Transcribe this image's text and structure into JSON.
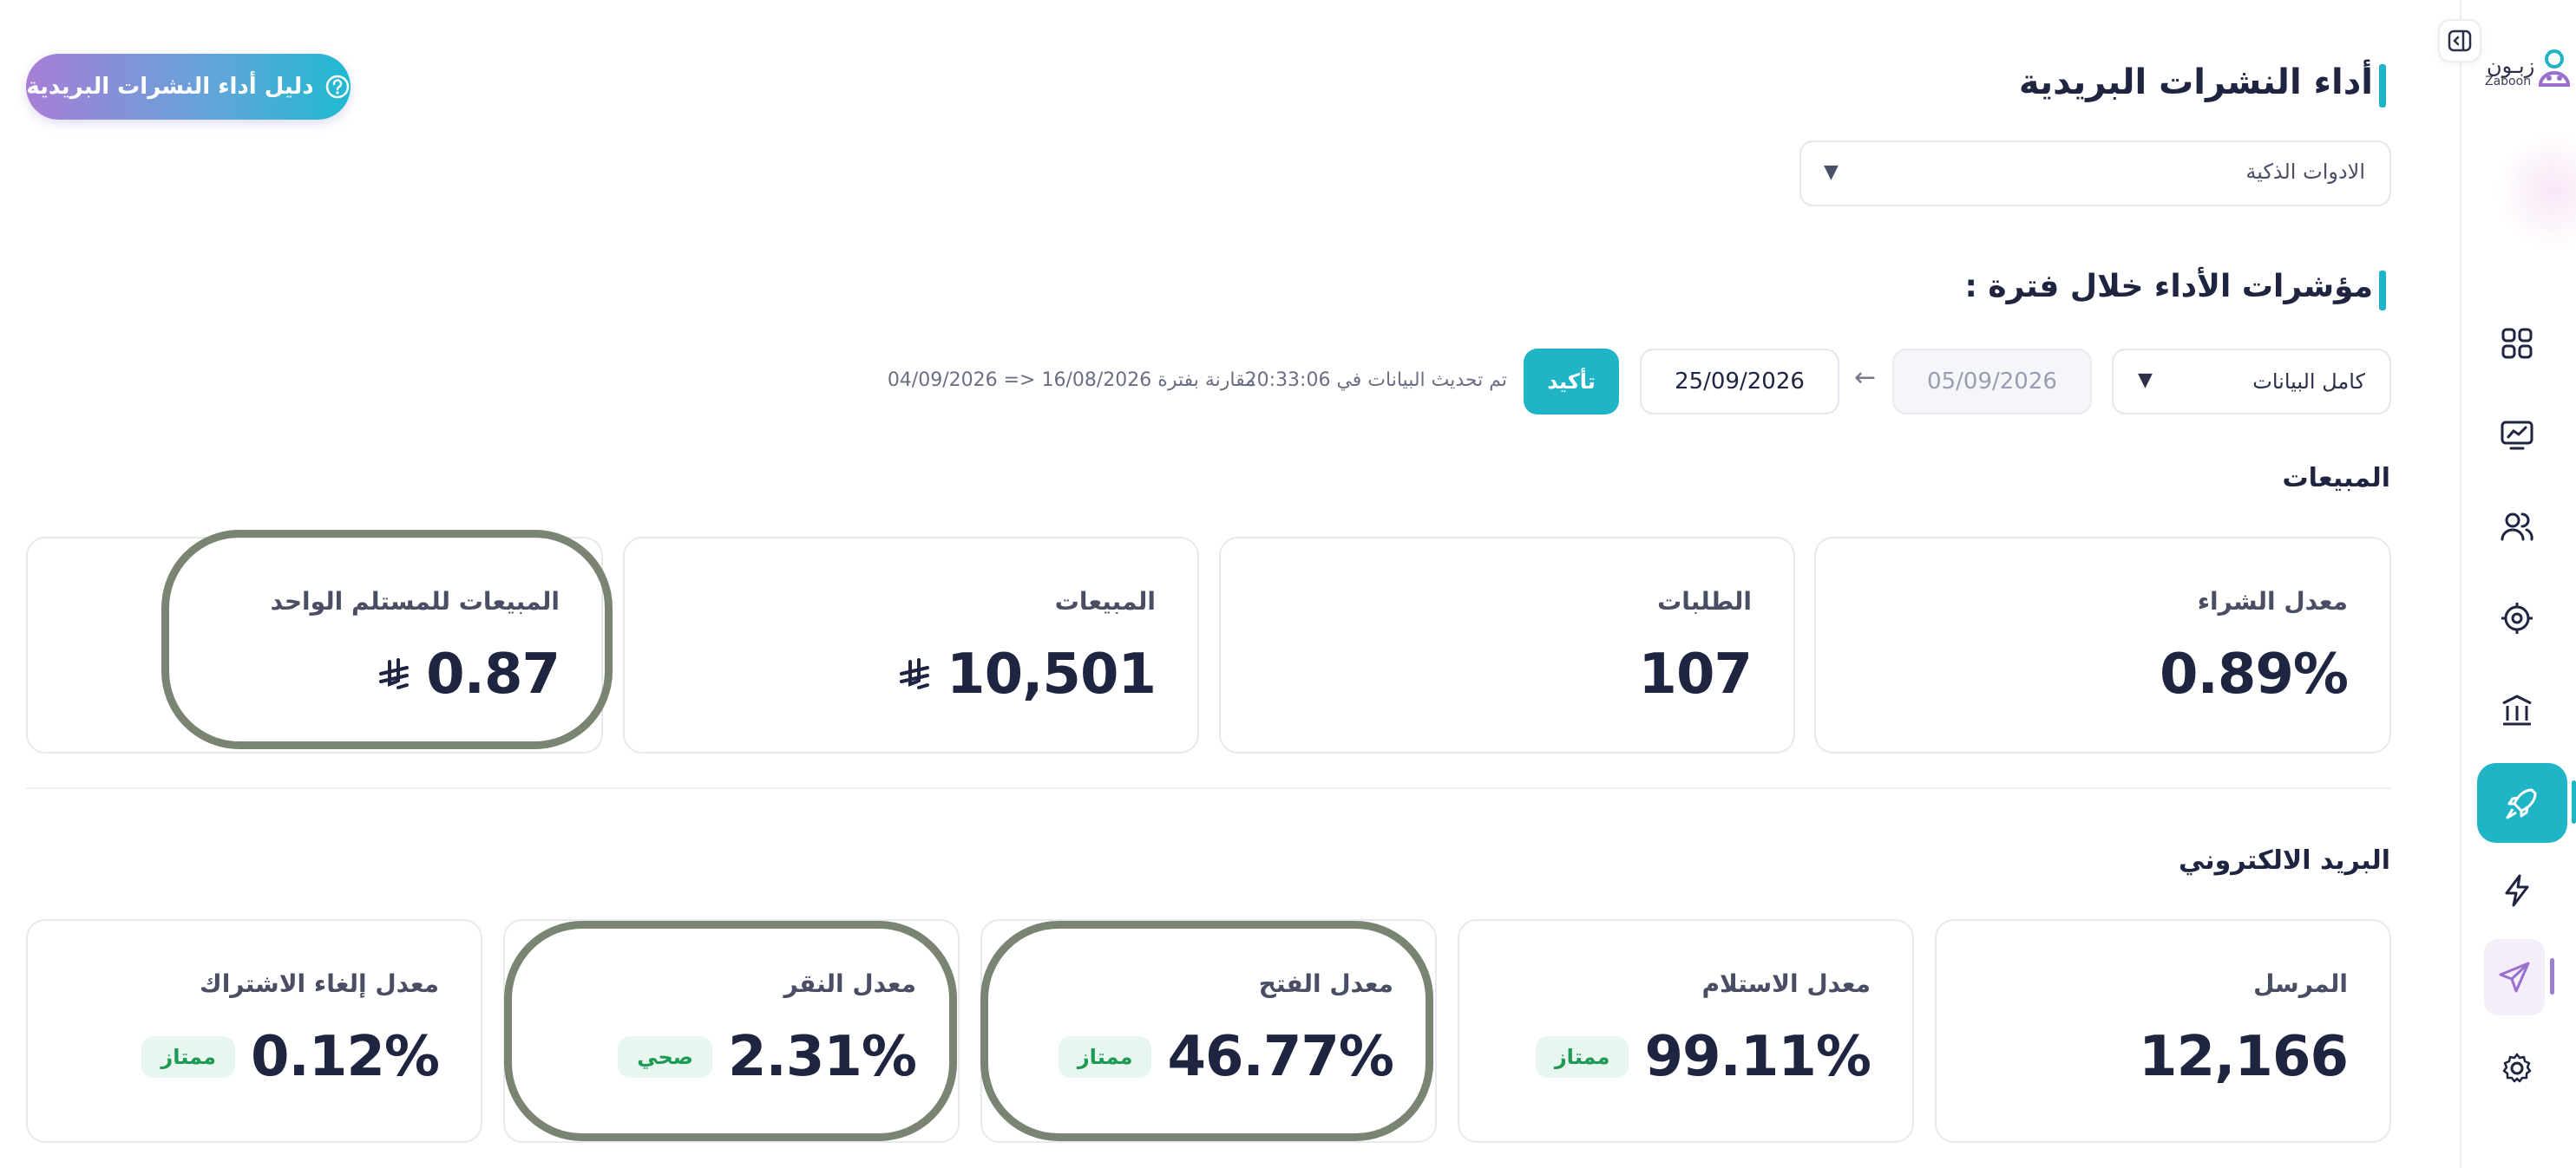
{
  "brand": {
    "name_ar": "زبـون",
    "name_en": "Zaboon"
  },
  "header": {
    "title": "أداء النشرات البريدية",
    "guide_button": "دليل أداء النشرات البريدية",
    "tool_select": "الادوات الذكية"
  },
  "kpi": {
    "title": "مؤشرات الأداء خلال فترة :",
    "period_select": "كامل البيانات",
    "date_from": "05/09/2026",
    "date_to": "25/09/2026",
    "date_arrow": "←",
    "confirm": "تأكيد",
    "updated": "تم تحديث البيانات في 20:33:06",
    "compare": "مقارنة بفترة 16/08/2026 <= 04/09/2026"
  },
  "sales": {
    "title": "المبيعات",
    "cards": [
      {
        "label": "معدل الشراء",
        "value": "0.89%"
      },
      {
        "label": "الطلبات",
        "value": "107"
      },
      {
        "label": "المبيعات",
        "value": "10,501"
      },
      {
        "label": "المبيعات للمستلم الواحد",
        "value": "0.87"
      }
    ]
  },
  "email": {
    "title": "البريد الالكتروني",
    "cards": [
      {
        "label": "المرسل",
        "value": "12,166"
      },
      {
        "label": "معدل الاستلام",
        "value": "99.11%",
        "badge": "ممتاز"
      },
      {
        "label": "معدل الفتح",
        "value": "46.77%",
        "badge": "ممتاز"
      },
      {
        "label": "معدل النقر",
        "value": "2.31%",
        "badge": "صحي"
      },
      {
        "label": "معدل إلغاء الاشتراك",
        "value": "0.12%",
        "badge": "ممتاز"
      }
    ]
  },
  "sidebar": {
    "icons": [
      "dashboard-icon",
      "analytics-icon",
      "customers-icon",
      "target-icon",
      "finance-icon",
      "campaigns-icon",
      "automation-icon",
      "newsletters-icon",
      "settings-icon"
    ]
  },
  "colors": {
    "accent": "#1fb4c6",
    "good_badge_bg": "#e7f6ee",
    "good_badge_text": "#1e9a55",
    "title": "#1f2440"
  }
}
